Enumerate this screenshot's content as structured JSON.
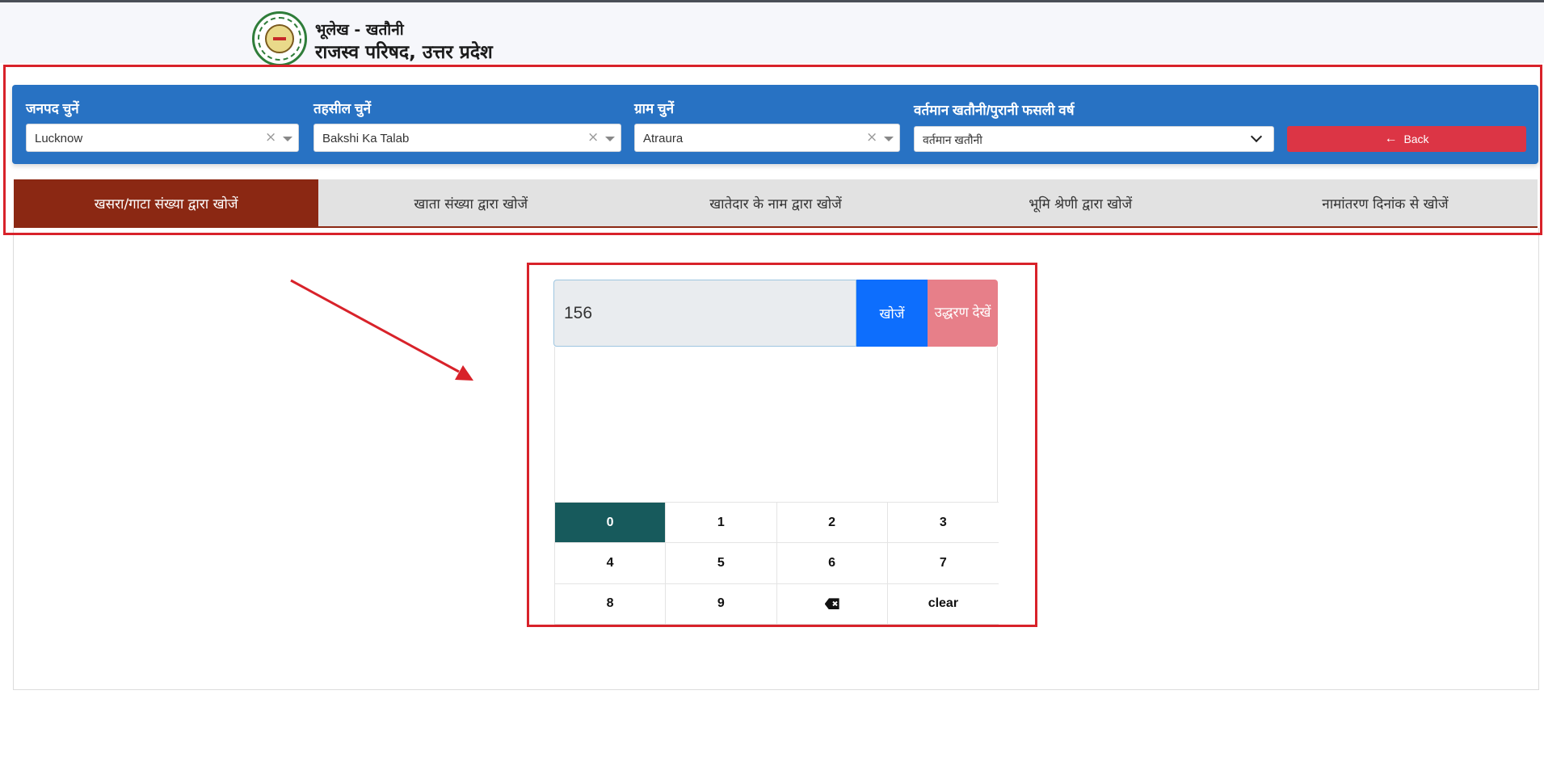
{
  "header": {
    "line1": "भूलेख - खतौनी",
    "line2": "राजस्व परिषद, उत्तर प्रदेश"
  },
  "filters": {
    "district": {
      "label": "जनपद चुनें",
      "value": "Lucknow"
    },
    "tehsil": {
      "label": "तहसील चुनें",
      "value": "Bakshi Ka Talab"
    },
    "village": {
      "label": "ग्राम चुनें",
      "value": "Atraura"
    },
    "year": {
      "label": "वर्तमान खतौनी/पुरानी फसली वर्ष",
      "value": "वर्तमान खतौनी"
    },
    "back_label": "Back"
  },
  "tabs": [
    {
      "label": "खसरा/गाटा संख्या द्वारा खोजें",
      "active": true
    },
    {
      "label": "खाता संख्या द्वारा खोजें",
      "active": false
    },
    {
      "label": "खातेदार के नाम द्वारा खोजें",
      "active": false
    },
    {
      "label": "भूमि श्रेणी द्वारा खोजें",
      "active": false
    },
    {
      "label": "नामांतरण दिनांक से खोजें",
      "active": false
    }
  ],
  "search": {
    "value": "156",
    "search_label": "खोजें",
    "view_label": "उद्धरण देखें"
  },
  "keypad": {
    "keys": [
      "0",
      "1",
      "2",
      "3",
      "4",
      "5",
      "6",
      "7",
      "8",
      "9",
      "",
      "clear"
    ],
    "pressed": "0"
  },
  "colors": {
    "panel": "#2872c3",
    "tab_active": "#8b2813",
    "back": "#dc3545",
    "search_btn": "#0d6efd",
    "view_btn": "#e77f89",
    "key_pressed": "#175a5c",
    "annotation": "#d8222a"
  }
}
